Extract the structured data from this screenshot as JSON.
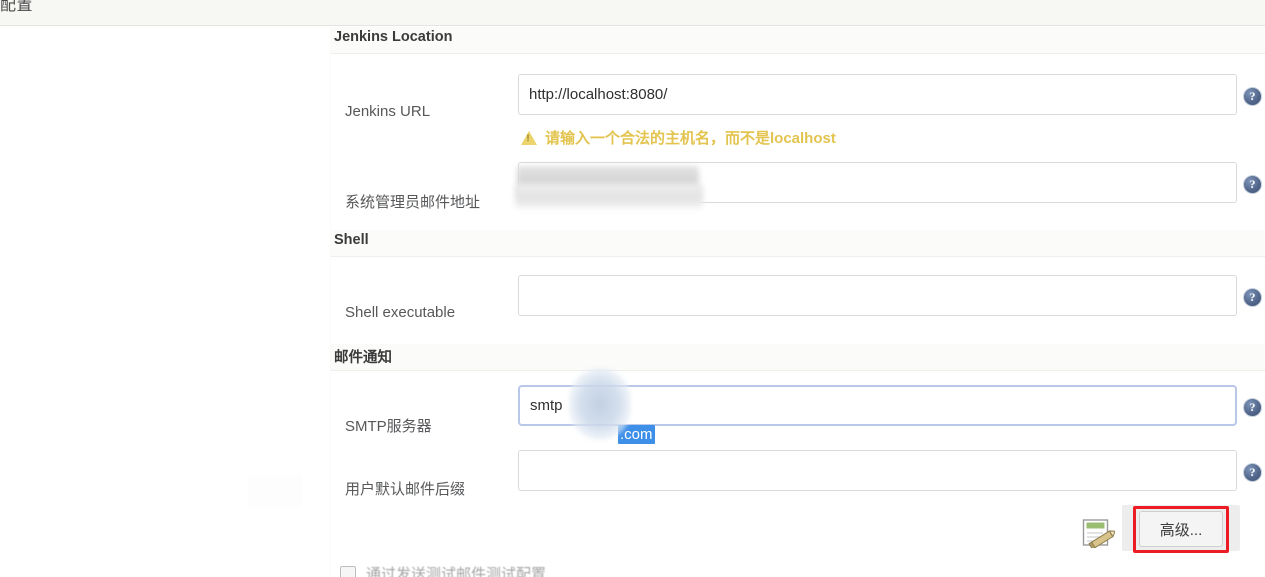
{
  "topbar": {
    "title": "配置"
  },
  "sections": [
    {
      "id": "jenkins_location",
      "title": "Jenkins Location"
    },
    {
      "id": "shell",
      "title": "Shell"
    },
    {
      "id": "mail_notification",
      "title": "邮件通知"
    }
  ],
  "fields": {
    "jenkins_url": {
      "label": "Jenkins URL",
      "value": "http://localhost:8080/",
      "placeholder": "",
      "warning": "请输入一个合法的主机名，而不是localhost",
      "warning_color": "#e3c44f"
    },
    "admin_email": {
      "label": "系统管理员邮件地址",
      "value": "",
      "placeholder": "",
      "redacted": true
    },
    "shell_executable": {
      "label": "Shell executable",
      "value": "",
      "placeholder": ""
    },
    "smtp_server": {
      "label": "SMTP服务器",
      "value_prefix": "smtp",
      "value_selected": ".com",
      "placeholder": "",
      "focused": true,
      "redacted": true
    },
    "default_user_email_suffix": {
      "label": "用户默认邮件后缀",
      "value": "",
      "placeholder": ""
    }
  },
  "buttons": {
    "advanced": {
      "label": "高级...",
      "highlighted": true,
      "highlight_color": "#ec1c24"
    }
  },
  "icons": {
    "help": "?",
    "warning": "⚠",
    "edit": "edit-note-icon"
  },
  "bottom": {
    "test_config_checkbox_label": "通过发送测试邮件测试配置",
    "checked": false
  },
  "colors": {
    "topbar_bg": "#f7f7f4",
    "section_bg": "#fbfbf9",
    "input_border": "#d9d9d9",
    "focus_border": "#b9c7e8",
    "selection": "#3e8fe8",
    "label_text": "#57585a"
  }
}
